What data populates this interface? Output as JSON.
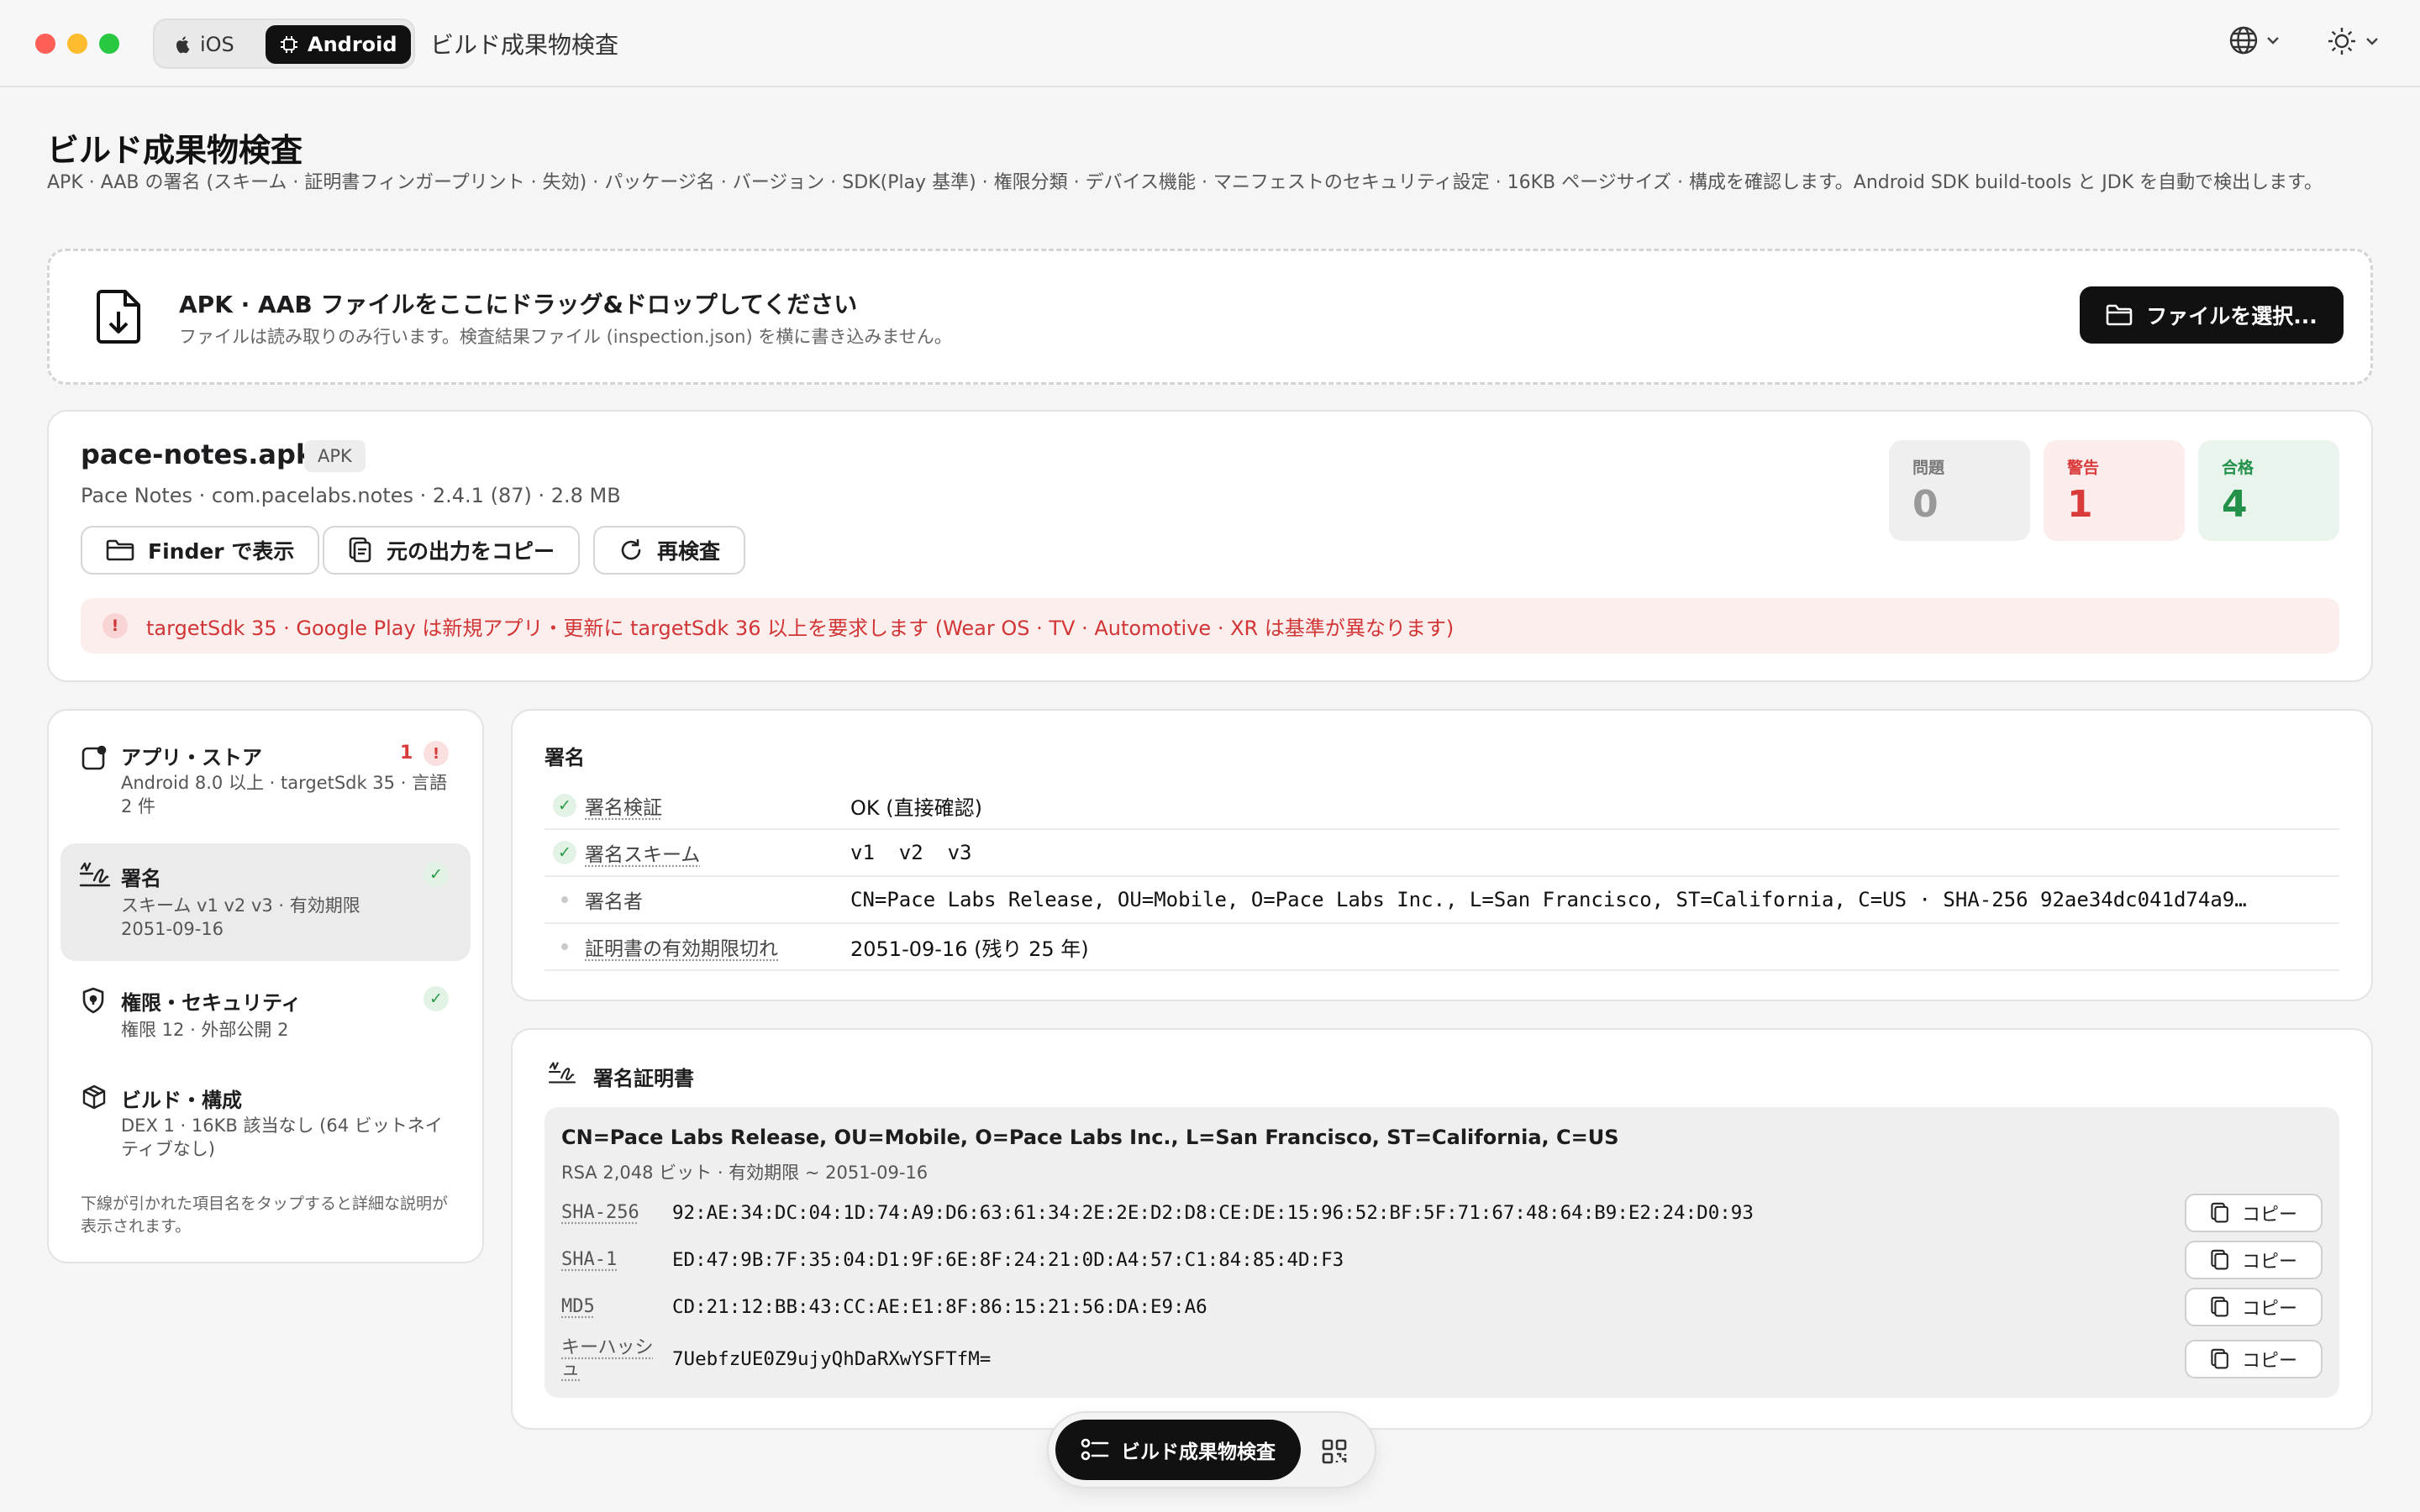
{
  "titlebar": {
    "platform_ios": "iOS",
    "platform_android": "Android",
    "app_title": "ビルド成果物検査",
    "traffic_colors": [
      "#ff5f57",
      "#febc2e",
      "#28c840"
    ]
  },
  "header": {
    "title": "ビルド成果物検査",
    "description": "APK · AAB の署名 (スキーム · 証明書フィンガープリント · 失効) · パッケージ名 · バージョン · SDK(Play 基準) · 権限分類 · デバイス機能 · マニフェストのセキュリティ設定 · 16KB ページサイズ · 構成を確認します。Android SDK build-tools と JDK を自動で検出します。"
  },
  "dropzone": {
    "title": "APK · AAB ファイルをここにドラッグ&ドロップしてください",
    "subtitle": "ファイルは読み取りのみ行います。検査結果ファイル (inspection.json) を横に書き込みません。",
    "select_button": "ファイルを選択..."
  },
  "file": {
    "name": "pace-notes.apk",
    "type_badge": "APK",
    "meta": "Pace Notes · com.pacelabs.notes · 2.4.1 (87) · 2.8 MB",
    "actions": {
      "finder": "Finder で表示",
      "copy_raw": "元の出力をコピー",
      "recheck": "再検査"
    },
    "stats": {
      "issues_label": "問題",
      "issues_value": "0",
      "warnings_label": "警告",
      "warnings_value": "1",
      "passed_label": "合格",
      "passed_value": "4"
    },
    "alert": "targetSdk 35 · Google Play は新規アプリ・更新に targetSdk 36 以上を要求します (Wear OS · TV · Automotive · XR は基準が異なります)"
  },
  "sidebar": {
    "items": [
      {
        "title": "アプリ・ストア",
        "subtitle": "Android 8.0 以上 · targetSdk 35 · 言語 2 件",
        "count": "1"
      },
      {
        "title": "署名",
        "subtitle": "スキーム v1 v2 v3 · 有効期限 2051-09-16"
      },
      {
        "title": "権限・セキュリティ",
        "subtitle": "権限 12 · 外部公開 2"
      },
      {
        "title": "ビルド・構成",
        "subtitle": "DEX 1 · 16KB 該当なし (64 ビットネイティブなし)"
      }
    ],
    "footnote": "下線が引かれた項目名をタップすると詳細な説明が表示されます。"
  },
  "signature": {
    "heading": "署名",
    "rows": [
      {
        "key": "署名検証",
        "value": "OK (直接確認)"
      },
      {
        "key": "署名スキーム",
        "value": "v1  v2  v3"
      },
      {
        "key": "署名者",
        "value": "CN=Pace Labs Release, OU=Mobile, O=Pace Labs Inc., L=San Francisco, ST=California, C=US · SHA-256 92ae34dc041d74a9…"
      },
      {
        "key": "証明書の有効期限切れ",
        "value": "2051-09-16 (残り 25 年)"
      }
    ]
  },
  "certificate": {
    "heading": "署名証明書",
    "subject": "CN=Pace Labs Release, OU=Mobile, O=Pace Labs Inc., L=San Francisco, ST=California, C=US",
    "meta": "RSA 2,048 ビット · 有効期限 ~ 2051-09-16",
    "copy_label": "コピー",
    "fingerprints": [
      {
        "key": "SHA-256",
        "value": "92:AE:34:DC:04:1D:74:A9:D6:63:61:34:2E:2E:D2:D8:CE:DE:15:96:52:BF:5F:71:67:48:64:B9:E2:24:D0:93"
      },
      {
        "key": "SHA-1",
        "value": "ED:47:9B:7F:35:04:D1:9F:6E:8F:24:21:0D:A4:57:C1:84:85:4D:F3"
      },
      {
        "key": "MD5",
        "value": "CD:21:12:BB:43:CC:AE:E1:8F:86:15:21:56:DA:E9:A6"
      },
      {
        "key": "キーハッシュ",
        "value": "7UebfzUE0Z9ujyQhDaRXwYSFTfM="
      }
    ]
  },
  "dock": {
    "active_label": "ビルド成果物検査"
  }
}
